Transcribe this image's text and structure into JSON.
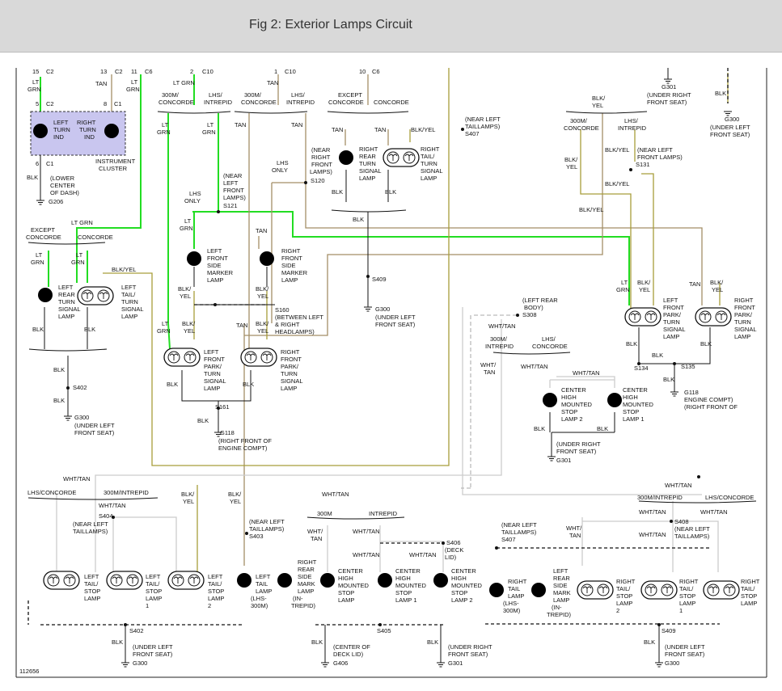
{
  "title": "Fig 2: Exterior Lamps Circuit",
  "figure_number": "112656",
  "labels": {
    "l15": "15",
    "lc2a": "C2",
    "l13": "13",
    "lc2b": "C2",
    "l11": "11",
    "lc6a": "C6",
    "l2": "2",
    "lc10a": "C10",
    "l1": "1",
    "lc10b": "C10",
    "l10": "10",
    "lc6b": "C6",
    "ltgrn1": "LT",
    "ltgrn1b": "GRN",
    "tan1": "TAN",
    "ltgrn2": "LT",
    "ltgrn2b": "GRN",
    "ltgrn3": "LT GRN",
    "tan2": "TAN",
    "pin5": "5",
    "c2c": "C2",
    "pin8": "8",
    "c1a": "C1",
    "lti_1": "LEFT",
    "lti_2": "TURN",
    "lti_3": "IND",
    "rti_1": "RIGHT",
    "rti_2": "TURN",
    "rti_3": "IND",
    "ic_1": "INSTRUMENT",
    "ic_2": "CLUSTER",
    "pin6": "6",
    "c1b": "C1",
    "blk_ic": "BLK",
    "lcd_1": "(LOWER",
    "lcd_2": "CENTER",
    "lcd_3": "OF DASH)",
    "g206": "G206",
    "conc300m_1": "300M/",
    "conc300m_2": "CONCORDE",
    "lhsint_1": "LHS/",
    "lhsint_2": "INTREPID",
    "conc300m_3": "300M/",
    "conc300m_4": "CONCORDE",
    "lhsint_3": "LHS/",
    "lhsint_4": "INTREPID",
    "except1": "EXCEPT",
    "except1b": "CONCORDE",
    "conc1": "CONCORDE",
    "s407a_1": "(NEAR LEFT",
    "s407a_2": "TAILLAMPS)",
    "s407a": "S407",
    "g301top": "G301",
    "g301top_1": "(UNDER RIGHT",
    "g301top_2": "FRONT SEAT)",
    "blk_tr": "BLK",
    "g300tr": "G300",
    "g300tr_1": "(UNDER LEFT",
    "g300tr_2": "FRONT SEAT)",
    "blkyel_tr": "BLK/",
    "blkyel_tr2": "YEL",
    "c300m_tr1": "300M/",
    "c300m_tr2": "CONCORDE",
    "lhs_tr1": "LHS/",
    "lhs_tr2": "INTREPID",
    "blkyel_s131a": "BLK/",
    "blkyel_s131b": "YEL",
    "nlfl_1": "(NEAR LEFT",
    "nlfl_2": "FRONT LAMPS)",
    "s131": "S131",
    "blkyel_s131c": "BLK/YEL",
    "blkyel_s131d": "BLK/YEL",
    "blkyel_s131e": "BLK/YEL",
    "tan_rrtsl": "TAN",
    "tan_rrtsl2": "TAN",
    "blkyel_rrtsl": "BLK/YEL",
    "rrtsl_1": "RIGHT",
    "rrtsl_2": "REAR",
    "rrtsl_3": "TURN",
    "rrtsl_4": "SIGNAL",
    "rrtsl_5": "LAMP",
    "rtsl_1": "RIGHT",
    "rtsl_2": "TAIL/",
    "rtsl_3": "TURN",
    "rtsl_4": "SIGNAL",
    "rtsl_5": "LAMP",
    "blk_rr1": "BLK",
    "blk_rr2": "BLK",
    "blk_rr3": "BLK",
    "nrfl_1": "(NEAR",
    "nrfl_2": "RIGHT",
    "nrfl_3": "FRONT",
    "nrfl_4": "LAMPS)",
    "s120": "S120",
    "lhsonly1": "LHS",
    "lhsonly1b": "ONLY",
    "s409a": "S409",
    "g300c": "G300",
    "g300c_1": "(UNDER LEFT",
    "g300c_2": "FRONT SEAT)",
    "nlfl2_1": "(NEAR",
    "nlfl2_2": "LEFT",
    "nlfl2_3": "FRONT",
    "nlfl2_4": "LAMPS)",
    "lhsonly2": "LHS",
    "lhsonly2b": "ONLY",
    "s121": "S121",
    "ltgrn_lfsm": "LT",
    "ltgrn_lfsm2": "GRN",
    "lfsm_1": "LEFT",
    "lfsm_2": "FRONT",
    "lfsm_3": "SIDE",
    "lfsm_4": "MARKER",
    "lfsm_5": "LAMP",
    "tan_rfsm": "TAN",
    "rfsm_1": "RIGHT",
    "rfsm_2": "FRONT",
    "rfsm_3": "SIDE",
    "rfsm_4": "MARKER",
    "rfsm_5": "LAMP",
    "blkyel_lfsm": "BLK/",
    "blkyel_lfsm2": "YEL",
    "blkyel_rfsm": "BLK/",
    "blkyel_rfsm2": "YEL",
    "s160_1": "S160",
    "s160_2": "(BETWEEN LEFT",
    "s160_3": "& RIGHT",
    "s160_4": "HEADLAMPS)",
    "except2": "EXCEPT",
    "except2b": "CONCORDE",
    "conc2": "CONCORDE",
    "ltgrn_lr": "LT",
    "ltgrn_lr2": "GRN",
    "ltgrn_lt": "LT",
    "ltgrn_lt2": "GRN",
    "blkyel_lt": "BLK/YEL",
    "lrtsl_1": "LEFT",
    "lrtsl_2": "REAR",
    "lrtsl_3": "TURN",
    "lrtsl_4": "SIGNAL",
    "lrtsl_5": "LAMP",
    "ltts_1": "LEFT",
    "ltts_2": "TAIL/",
    "ltts_3": "TURN",
    "ltts_4": "SIGNAL",
    "ltts_5": "LAMP",
    "blk_lr": "BLK",
    "blk_lt": "BLK",
    "blk_s402": "BLK",
    "s402a": "S402",
    "blk_s402b": "BLK",
    "g300d": "G300",
    "g300d_1": "(UNDER LEFT",
    "g300d_2": "FRONT SEAT)",
    "ltgrn_lfp": "LT",
    "ltgrn_lfp2": "GRN",
    "blkyel_lfp": "BLK/",
    "blkyel_lfp2": "YEL",
    "tan_rfp": "TAN",
    "blkyel_rfp": "BLK/",
    "blkyel_rfp2": "YEL",
    "lfp_1": "LEFT",
    "lfp_2": "FRONT",
    "lfp_3": "PARK/",
    "lfp_4": "TURN",
    "lfp_5": "SIGNAL",
    "lfp_6": "LAMP",
    "rfp_1": "RIGHT",
    "rfp_2": "FRONT",
    "rfp_3": "PARK/",
    "rfp_4": "TURN",
    "rfp_5": "SIGNAL",
    "rfp_6": "LAMP",
    "blk_lfp": "BLK",
    "blk_rfp": "BLK",
    "s161": "S161",
    "blk_s161": "BLK",
    "g118a": "G118",
    "g118a_1": "(RIGHT FRONT OF",
    "g118a_2": "ENGINE COMPT)",
    "lrb_1": "(LEFT REAR",
    "lrb_2": "BODY)",
    "s308": "S308",
    "whttan_s308": "WHT/TAN",
    "c300m_m1": "300M/",
    "c300m_m2": "INTREPID",
    "lhs_m1": "LHS/",
    "lhs_m2": "CONCORDE",
    "whttan_m1": "WHT/",
    "whttan_m2": "TAN",
    "whttan_m3": "WHT/TAN",
    "whttan_m4": "WHT/TAN",
    "chms2_1": "CENTER",
    "chms2_2": "HIGH",
    "chms2_3": "MOUNTED",
    "chms2_4": "STOP",
    "chms2_5": "LAMP 2",
    "chms1_1": "CENTER",
    "chms1_2": "HIGH",
    "chms1_3": "MOUNTED",
    "chms1_4": "STOP",
    "chms1_5": "LAMP 1",
    "blk_chms2": "BLK",
    "blk_chms1": "BLK",
    "g301m_1": "(UNDER RIGHT",
    "g301m_2": "FRONT SEAT)",
    "g301m": "G301",
    "ltgrn_lfpt": "LT",
    "ltgrn_lfpt2": "GRN",
    "blkyel_lfpt": "BLK/",
    "blkyel_lfpt2": "YEL",
    "tan_rfpt": "TAN",
    "blkyel_rfpt": "BLK/",
    "blkyel_rfpt2": "YEL",
    "lfpt_1": "LEFT",
    "lfpt_2": "FRONT",
    "lfpt_3": "PARK/",
    "lfpt_4": "TURN",
    "lfpt_5": "SIGNAL",
    "lfpt_6": "LAMP",
    "rfpt_1": "RIGHT",
    "rfpt_2": "FRONT",
    "rfpt_3": "PARK/",
    "rfpt_4": "TURN",
    "rfpt_5": "SIGNAL",
    "rfpt_6": "LAMP",
    "blk_lfpt": "BLK",
    "blk_rfpt": "BLK",
    "blk_s134": "BLK",
    "s134": "S134",
    "s135": "S135",
    "blk_s135": "BLK",
    "g118b": "G118",
    "g118b_1": "ENGINE COMPT)",
    "g118b_2": "(RIGHT FRONT OF",
    "whttan_b1": "WHT/TAN",
    "lhsconc_b": "LHS/CONCORDE",
    "c300m_b": "300M/INTREPID",
    "whttan_b2": "WHT/TAN",
    "s404": "S404",
    "s404_1": "(NEAR LEFT",
    "s404_2": "TAILLAMPS)",
    "blkyel_b1": "BLK/",
    "blkyel_b1b": "YEL",
    "blkyel_b2": "BLK/",
    "blkyel_b2b": "YEL",
    "s403_1": "(NEAR LEFT",
    "s403_2": "TAILLAMPS)",
    "s403": "S403",
    "whttan_b3": "WHT/TAN",
    "m300_b": "300M",
    "int_b": "INTREPID",
    "whttan_b4": "WHT/",
    "whttan_b4b": "TAN",
    "whttan_b5": "WHT/TAN",
    "whttan_b6": "WHT/TAN",
    "whttan_b7": "WHT/TAN",
    "s406": "S406",
    "s406_1": "(DECK",
    "s406_2": "LID)",
    "s407b_1": "(NEAR LEFT",
    "s407b_2": "TAILLAMPS)",
    "s407b": "S407",
    "whttan_r1": "WHT/TAN",
    "c300m_r": "300M/INTREPID",
    "lhsconc_r": "LHS/CONCORDE",
    "whttan_r2": "WHT/TAN",
    "whttan_r3": "WHT/TAN",
    "whttan_r4": "WHT/",
    "whttan_r4b": "TAN",
    "s408": "S408",
    "s408_1": "(NEAR LEFT",
    "s408_2": "TAILLAMPS)",
    "whttan_r5": "WHT/TAN",
    "b_ltsl_1": "LEFT",
    "b_ltsl_2": "TAIL/",
    "b_ltsl_3": "STOP",
    "b_ltsl_4": "LAMP",
    "b_ltsl1_1": "LEFT",
    "b_ltsl1_2": "TAIL/",
    "b_ltsl1_3": "STOP",
    "b_ltsl1_4": "LAMP",
    "b_ltsl1_5": "1",
    "b_ltsl2_1": "LEFT",
    "b_ltsl2_2": "TAIL/",
    "b_ltsl2_3": "STOP",
    "b_ltsl2_4": "LAMP",
    "b_ltsl2_5": "2",
    "b_ltl_1": "LEFT",
    "b_ltl_2": "TAIL",
    "b_ltl_3": "LAMP",
    "b_ltl_4": "(LHS-",
    "b_ltl_5": "300M)",
    "b_rrsm_1": "RIGHT",
    "b_rrsm_2": "REAR",
    "b_rrsm_3": "SIDE",
    "b_rrsm_4": "MARK",
    "b_rrsm_5": "LAMP",
    "b_rrsm_6": "(IN-",
    "b_rrsm_7": "TREPID)",
    "b_chms_1": "CENTER",
    "b_chms_2": "HIGH",
    "b_chms_3": "MOUNTED",
    "b_chms_4": "STOP",
    "b_chms_5": "LAMP",
    "b_chms1_1": "CENTER",
    "b_chms1_2": "HIGH",
    "b_chms1_3": "MOUNTED",
    "b_chms1_4": "STOP",
    "b_chms1_5": "LAMP 1",
    "b_chms2_1": "CENTER",
    "b_chms2_2": "HIGH",
    "b_chms2_3": "MOUNTED",
    "b_chms2_4": "STOP",
    "b_chms2_5": "LAMP 2",
    "b_rtl_1": "RIGHT",
    "b_rtl_2": "TAIL",
    "b_rtl_3": "LAMP",
    "b_rtl_4": "(LHS-",
    "b_rtl_5": "300M)",
    "b_lrsm_1": "LEFT",
    "b_lrsm_2": "REAR",
    "b_lrsm_3": "SIDE",
    "b_lrsm_4": "MARK",
    "b_lrsm_5": "LAMP",
    "b_lrsm_6": "(IN-",
    "b_lrsm_7": "TREPID)",
    "b_rtsl2_1": "RIGHT",
    "b_rtsl2_2": "TAIL/",
    "b_rtsl2_3": "STOP",
    "b_rtsl2_4": "LAMP",
    "b_rtsl2_5": "2",
    "b_rtsl1_1": "RIGHT",
    "b_rtsl1_2": "TAIL/",
    "b_rtsl1_3": "STOP",
    "b_rtsl1_4": "LAMP",
    "b_rtsl1_5": "1",
    "b_rtsl_1": "RIGHT",
    "b_rtsl_2": "TAIL/",
    "b_rtsl_3": "STOP",
    "b_rtsl_4": "LAMP",
    "s402b": "S402",
    "s405": "S405",
    "s409b": "S409",
    "blk_bl": "BLK",
    "g300e_1": "(UNDER LEFT",
    "g300e_2": "FRONT SEAT)",
    "g300e": "G300",
    "blk_bm": "BLK",
    "g406_1": "(CENTER OF",
    "g406_2": "DECK LID)",
    "g406": "G406",
    "blk_bm2": "BLK",
    "g301b_1": "(UNDER RIGHT",
    "g301b_2": "FRONT SEAT)",
    "g301b": "G301",
    "blk_br": "BLK",
    "g300f_1": "(UNDER LEFT",
    "g300f_2": "FRONT SEAT)",
    "g300f": "G300",
    "blk_gen": "BLK",
    "blkyel_gen": "BLK/",
    "yel_gen": "YEL",
    "whttan_gen": "WHT/",
    "tan_gen": "TAN"
  }
}
